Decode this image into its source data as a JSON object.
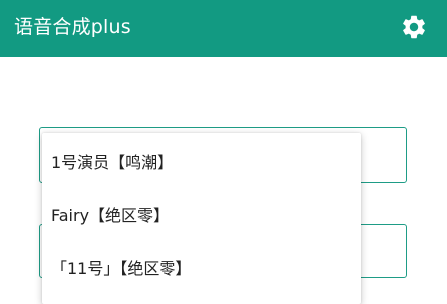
{
  "app": {
    "title": "语音合成plus"
  },
  "toolbar": {
    "settings_icon": "gear-icon"
  },
  "colors": {
    "primary": "#129a82",
    "field_border": "#1e9c86"
  },
  "voice_dropdown": {
    "options": [
      {
        "label": "1号演员【鸣潮】"
      },
      {
        "label": "Fairy【绝区零】"
      },
      {
        "label": "「11号」【绝区零】"
      }
    ]
  }
}
